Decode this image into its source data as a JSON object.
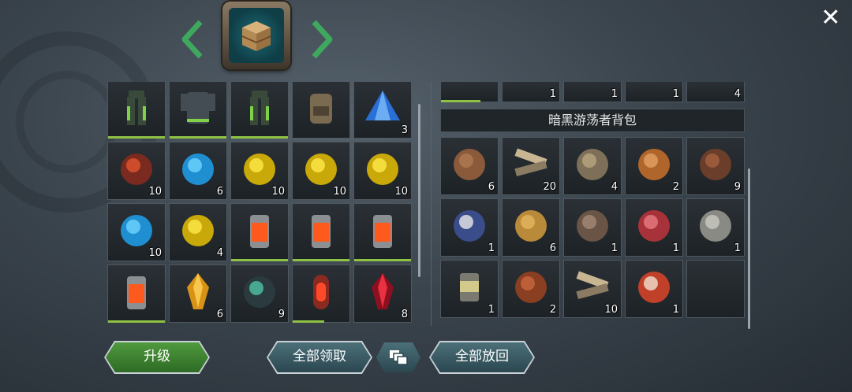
{
  "header": {
    "bag_icon": "wooden-crate-icon",
    "close_icon": "close-icon",
    "prev_icon": "chevron-left-icon",
    "next_icon": "chevron-right-icon"
  },
  "left_grid": {
    "items": [
      {
        "icon": "green-pants-icon",
        "count": "",
        "bar": 1.0
      },
      {
        "icon": "armor-vest-icon",
        "count": "",
        "bar": 1.0
      },
      {
        "icon": "green-pants-icon",
        "count": "",
        "bar": 1.0
      },
      {
        "icon": "backpack-icon",
        "count": "",
        "bar": null
      },
      {
        "icon": "blue-crystal-pyramid-icon",
        "count": "3",
        "bar": null
      },
      {
        "icon": "red-spiked-orb-icon",
        "count": "10",
        "bar": null
      },
      {
        "icon": "blue-orb-icon",
        "count": "6",
        "bar": null
      },
      {
        "icon": "yellow-orb-icon",
        "count": "10",
        "bar": null
      },
      {
        "icon": "yellow-orb-icon",
        "count": "10",
        "bar": null
      },
      {
        "icon": "yellow-orb-icon",
        "count": "10",
        "bar": null
      },
      {
        "icon": "blue-orb-icon",
        "count": "10",
        "bar": null
      },
      {
        "icon": "yellow-orb-icon",
        "count": "4",
        "bar": null
      },
      {
        "icon": "fire-canister-icon",
        "count": "",
        "bar": 1.0
      },
      {
        "icon": "fire-canister-icon",
        "count": "",
        "bar": 1.0
      },
      {
        "icon": "fire-canister-icon",
        "count": "",
        "bar": 1.0
      },
      {
        "icon": "fire-canister-icon",
        "count": "",
        "bar": 1.0
      },
      {
        "icon": "amber-crystal-icon",
        "count": "6",
        "bar": null
      },
      {
        "icon": "dark-ore-icon",
        "count": "9",
        "bar": null
      },
      {
        "icon": "red-capsule-icon",
        "count": "",
        "bar": 0.55
      },
      {
        "icon": "red-crystal-icon",
        "count": "8",
        "bar": null
      }
    ]
  },
  "right_top": {
    "items": [
      {
        "icon": "partial-item-icon",
        "count": "",
        "bar": 0.7
      },
      {
        "icon": "partial-item-icon",
        "count": "1",
        "bar": null
      },
      {
        "icon": "partial-item-icon",
        "count": "1",
        "bar": null
      },
      {
        "icon": "partial-item-icon",
        "count": "1",
        "bar": null
      },
      {
        "icon": "partial-item-icon",
        "count": "4",
        "bar": null
      }
    ]
  },
  "right_section": {
    "title": "暗黑游荡者背包",
    "items": [
      {
        "icon": "leather-hide-icon",
        "count": "6"
      },
      {
        "icon": "wooden-planks-icon",
        "count": "20"
      },
      {
        "icon": "cloth-scraps-icon",
        "count": "4"
      },
      {
        "icon": "mushrooms-icon",
        "count": "2"
      },
      {
        "icon": "scrap-parts-icon",
        "count": "9"
      },
      {
        "icon": "cigarettes-icon",
        "count": "1"
      },
      {
        "icon": "potato-icon",
        "count": "6"
      },
      {
        "icon": "antlers-icon",
        "count": "1"
      },
      {
        "icon": "raw-meat-icon",
        "count": "1"
      },
      {
        "icon": "flint-stones-icon",
        "count": "1"
      },
      {
        "icon": "tin-can-icon",
        "count": "1"
      },
      {
        "icon": "copper-wire-icon",
        "count": "2"
      },
      {
        "icon": "wooden-planks-icon",
        "count": "10"
      },
      {
        "icon": "seed-packet-icon",
        "count": "1"
      },
      {
        "icon": "",
        "count": ""
      }
    ]
  },
  "buttons": {
    "upgrade": "升级",
    "claim_all": "全部领取",
    "return_all": "全部放回",
    "stack_icon": "stack-icon"
  }
}
